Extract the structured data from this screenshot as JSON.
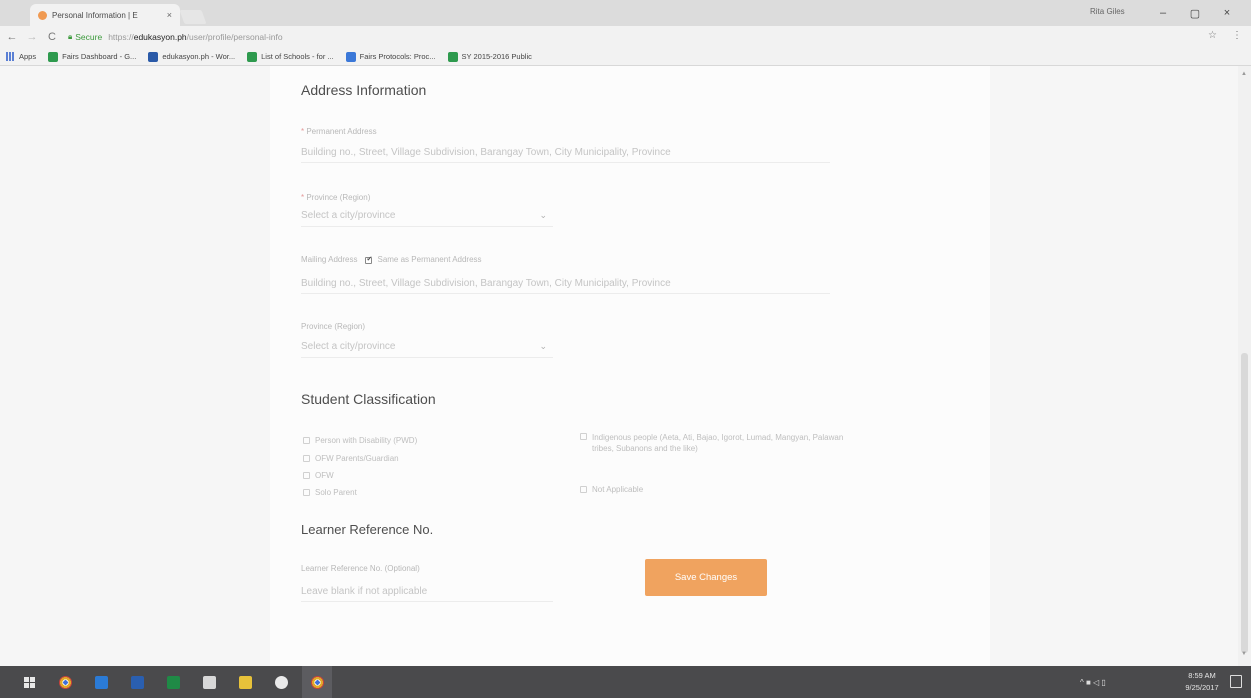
{
  "browser": {
    "tab_title": "Personal Information | E",
    "tab_close": "×",
    "profile_name": "Rita Giles",
    "window_controls": {
      "minimize": "–",
      "maximize": "▢",
      "close": "×"
    },
    "nav": {
      "back": "←",
      "forward": "→",
      "reload": "C"
    },
    "secure_label": "Secure",
    "url_scheme": "https://",
    "url_host": "edukasyon.ph",
    "url_path": "/user/profile/personal-info",
    "star_icon": "star-icon",
    "bookmarks": [
      {
        "label": "Apps",
        "color": "#5a7fd4"
      },
      {
        "label": "Fairs Dashboard - G...",
        "color": "#2e9a4e"
      },
      {
        "label": "edukasyon.ph - Wor...",
        "color": "#2a5aa8"
      },
      {
        "label": "List of Schools - for ...",
        "color": "#2e9a4e"
      },
      {
        "label": "Fairs Protocols: Proc...",
        "color": "#3b78d8"
      },
      {
        "label": "SY 2015-2016 Public",
        "color": "#2e9a4e"
      }
    ]
  },
  "form": {
    "address_section_title": "Address Information",
    "permanent_address": {
      "label": "Permanent Address",
      "placeholder": "Building no., Street, Village Subdivision, Barangay Town, City Municipality, Province"
    },
    "province1": {
      "label": "Province (Region)",
      "value": "Select a city/province"
    },
    "mailing_address": {
      "label": "Mailing Address",
      "same_as_label": "Same as Permanent Address",
      "placeholder": "Building no., Street, Village Subdivision, Barangay Town, City Municipality, Province"
    },
    "province2": {
      "label": "Province (Region)",
      "value": "Select a city/province"
    },
    "classification_title": "Student Classification",
    "classification_left": [
      "Person with Disability (PWD)",
      "OFW Parents/Guardian",
      "OFW",
      "Solo Parent"
    ],
    "classification_right": [
      "Indigenous people (Aeta, Ati, Bajao, Igorot, Lumad, Mangyan, Palawan tribes, Subanons and the like)",
      "Not Applicable"
    ],
    "lrn_title": "Learner Reference No.",
    "lrn": {
      "label": "Learner Reference No. (Optional)",
      "placeholder": "Leave blank if not applicable"
    },
    "save_label": "Save Changes"
  },
  "taskbar": {
    "clock_time": "8:59 AM",
    "clock_date": "9/25/2017",
    "tray_text": "^ ■ ◁ ▯"
  },
  "colors": {
    "accent": "#f0a35f",
    "title_text": "#4e4e4e"
  }
}
